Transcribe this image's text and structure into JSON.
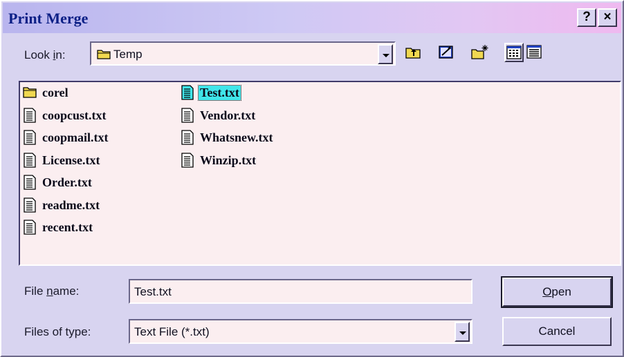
{
  "window": {
    "title": "Print Merge",
    "help_label": "?",
    "close_label": "×"
  },
  "look_in": {
    "label_pre": "Look ",
    "label_key": "i",
    "label_post": "n:",
    "value": "Temp"
  },
  "files": [
    {
      "name": "corel",
      "type": "folder",
      "selected": false
    },
    {
      "name": "coopcust.txt",
      "type": "text",
      "selected": false
    },
    {
      "name": "coopmail.txt",
      "type": "text",
      "selected": false
    },
    {
      "name": "License.txt",
      "type": "text",
      "selected": false
    },
    {
      "name": "Order.txt",
      "type": "text",
      "selected": false
    },
    {
      "name": "readme.txt",
      "type": "text",
      "selected": false
    },
    {
      "name": "recent.txt",
      "type": "text",
      "selected": false
    },
    {
      "name": "Test.txt",
      "type": "text",
      "selected": true
    },
    {
      "name": "Vendor.txt",
      "type": "text",
      "selected": false
    },
    {
      "name": "Whatsnew.txt",
      "type": "text",
      "selected": false
    },
    {
      "name": "Winzip.txt",
      "type": "text",
      "selected": false
    }
  ],
  "file_name": {
    "label_pre": "File ",
    "label_key": "n",
    "label_post": "ame:",
    "value": "Test.txt"
  },
  "file_type": {
    "label": "Files of type:",
    "value": "Text File (*.txt)"
  },
  "buttons": {
    "open_key": "O",
    "open_rest": "pen",
    "cancel": "Cancel"
  },
  "toolbar": {
    "icons": [
      "up-one-level-icon",
      "desktop-icon",
      "new-folder-icon",
      "list-view-icon",
      "details-view-icon"
    ]
  },
  "colors": {
    "title_text": "#0b1f86",
    "selection": "#40e6ea",
    "folder": "#f0d850"
  }
}
